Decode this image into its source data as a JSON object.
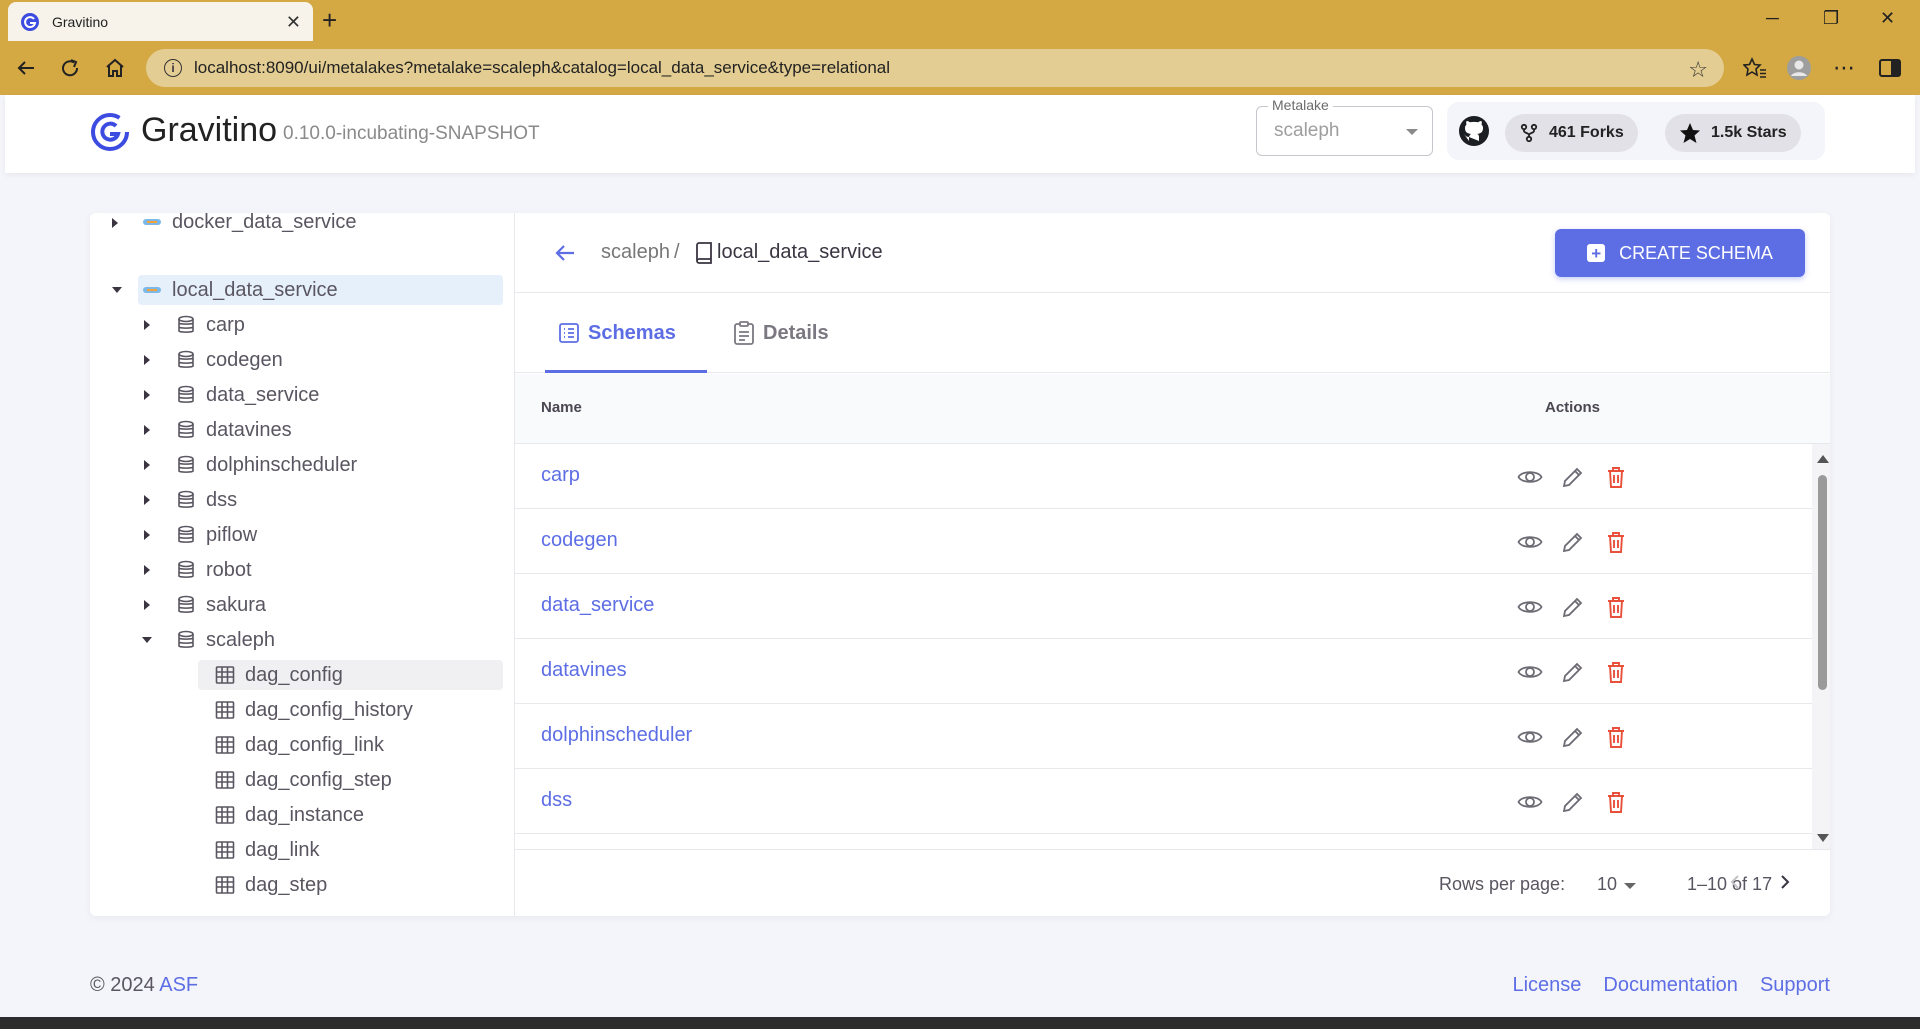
{
  "browser": {
    "tab_title": "Gravitino",
    "url": "localhost:8090/ui/metalakes?metalake=scaleph&catalog=local_data_service&type=relational"
  },
  "header": {
    "brand": "Gravitino",
    "version": "0.10.0-incubating-SNAPSHOT",
    "metalake_label": "Metalake",
    "metalake_value": "scaleph",
    "forks_label": "461 Forks",
    "stars_label": "1.5k Stars"
  },
  "tree": {
    "catalogs": [
      {
        "label": "docker_data_service"
      },
      {
        "label": "local_data_service"
      }
    ],
    "schemas": [
      {
        "label": "carp"
      },
      {
        "label": "codegen"
      },
      {
        "label": "data_service"
      },
      {
        "label": "datavines"
      },
      {
        "label": "dolphinscheduler"
      },
      {
        "label": "dss"
      },
      {
        "label": "piflow"
      },
      {
        "label": "robot"
      },
      {
        "label": "sakura"
      },
      {
        "label": "scaleph"
      }
    ],
    "tables": [
      {
        "label": "dag_config"
      },
      {
        "label": "dag_config_history"
      },
      {
        "label": "dag_config_link"
      },
      {
        "label": "dag_config_step"
      },
      {
        "label": "dag_instance"
      },
      {
        "label": "dag_link"
      },
      {
        "label": "dag_step"
      }
    ]
  },
  "breadcrumb": {
    "metalake": "scaleph",
    "separator": "/",
    "catalog": "local_data_service"
  },
  "create_button": "CREATE SCHEMA",
  "tabs": [
    {
      "label": "Schemas"
    },
    {
      "label": "Details"
    }
  ],
  "table": {
    "columns": {
      "name": "Name",
      "actions": "Actions"
    },
    "rows": [
      {
        "name": "carp"
      },
      {
        "name": "codegen"
      },
      {
        "name": "data_service"
      },
      {
        "name": "datavines"
      },
      {
        "name": "dolphinscheduler"
      },
      {
        "name": "dss"
      }
    ]
  },
  "pager": {
    "rows_per_page_label": "Rows per page:",
    "rows_per_page_value": "10",
    "range": "1–10 of 17"
  },
  "footer": {
    "copyright": "© 2024",
    "asf": "ASF",
    "links": [
      "License",
      "Documentation",
      "Support"
    ]
  },
  "colors": {
    "primary": "#5d6ee5",
    "delete": "#e8503a",
    "browser_chrome": "#d4a843"
  }
}
